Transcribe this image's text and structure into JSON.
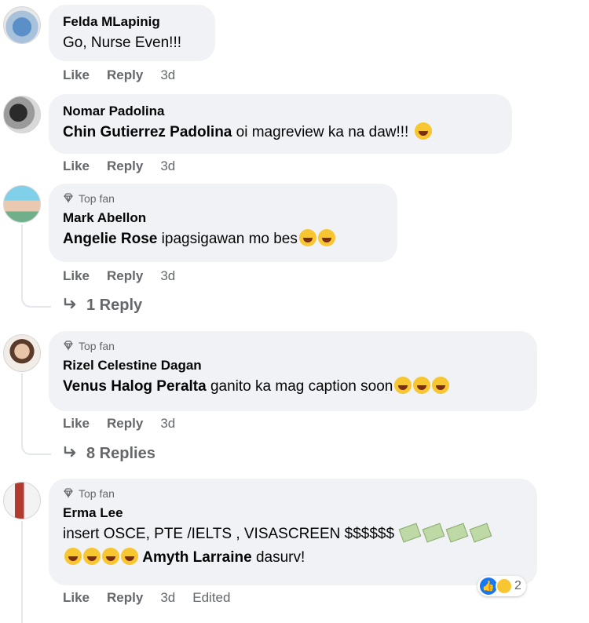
{
  "comments": [
    {
      "author": "Felda MLapinig",
      "top_fan": false,
      "text": "Go, Nurse Even!!!",
      "actions": {
        "like": "Like",
        "reply": "Reply",
        "time": "3d"
      }
    },
    {
      "author": "Nomar Padolina",
      "top_fan": false,
      "mention": "Chin Gutierrez Padolina",
      "text": "oi magreview ka na daw!!!",
      "actions": {
        "like": "Like",
        "reply": "Reply",
        "time": "3d"
      }
    },
    {
      "author": "Mark Abellon",
      "top_fan": true,
      "top_fan_label": "Top fan",
      "mention": "Angelie Rose",
      "text": "ipagsigawan mo bes",
      "actions": {
        "like": "Like",
        "reply": "Reply",
        "time": "3d"
      },
      "replies_label": "1 Reply"
    },
    {
      "author": "Rizel Celestine Dagan",
      "top_fan": true,
      "top_fan_label": "Top fan",
      "mention": "Venus Halog Peralta",
      "text": "ganito ka mag caption soon",
      "actions": {
        "like": "Like",
        "reply": "Reply",
        "time": "3d"
      },
      "replies_label": "8 Replies"
    },
    {
      "author": "Erma Lee",
      "top_fan": true,
      "top_fan_label": "Top fan",
      "text_line1": "insert OSCE, PTE /IELTS , VISASCREEN $$$$$$",
      "mention": "Amyth Larraine",
      "text_line2": "dasurv!",
      "actions": {
        "like": "Like",
        "reply": "Reply",
        "time": "3d",
        "edited": "Edited"
      },
      "reaction_count": "2"
    }
  ],
  "icons": {
    "top_fan": "diamond-icon",
    "reply_arrow": "reply-arrow-icon",
    "like_reaction": "thumbs-up-icon",
    "haha_reaction": "haha-emoji-icon"
  },
  "colors": {
    "bubble": "#f0f2f5",
    "secondary_text": "#65676b",
    "like_blue": "#1877f2"
  }
}
